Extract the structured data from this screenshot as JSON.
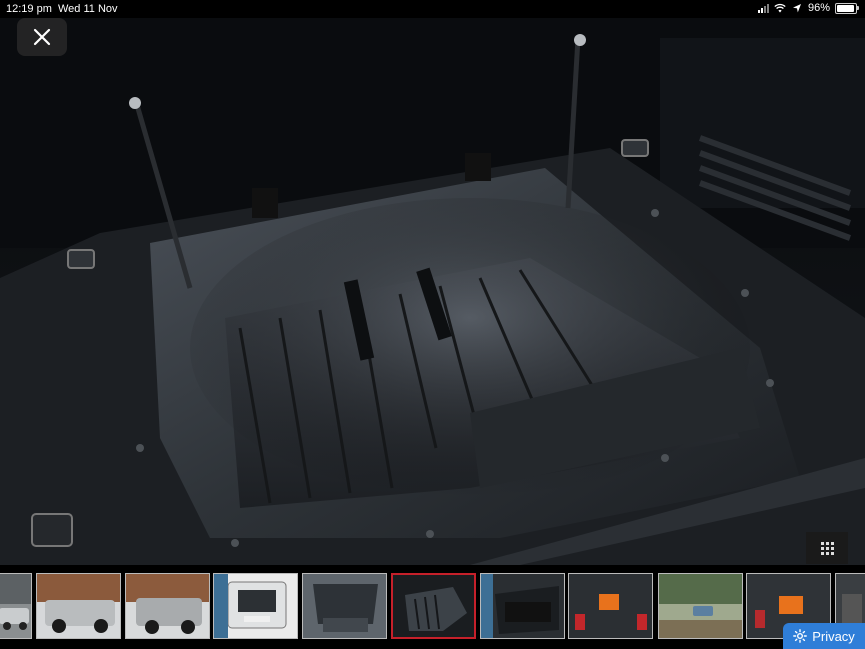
{
  "status_bar": {
    "time": "12:19 pm",
    "date": "Wed 11 Nov",
    "battery": "96%",
    "battery_level": 0.96
  },
  "viewer": {
    "close_icon": "close-icon",
    "grid_icon": "grid-icon",
    "thumbnail_count": 11,
    "active_thumbnail": 5
  },
  "thumbnails": [
    {
      "scene": "silver-suv-front"
    },
    {
      "scene": "silver-suv-side"
    },
    {
      "scene": "silver-suv-rear"
    },
    {
      "scene": "open-tailgate"
    },
    {
      "scene": "cargo-area"
    },
    {
      "scene": "cargo-tray"
    },
    {
      "scene": "under-floor-bin"
    },
    {
      "scene": "orange-case-boot"
    },
    {
      "scene": "offroad-forest"
    },
    {
      "scene": "orange-box-boot"
    },
    {
      "scene": "partial"
    }
  ],
  "privacy": {
    "label": "Privacy",
    "icon": "gear-icon",
    "color": "#2f7ed8"
  }
}
